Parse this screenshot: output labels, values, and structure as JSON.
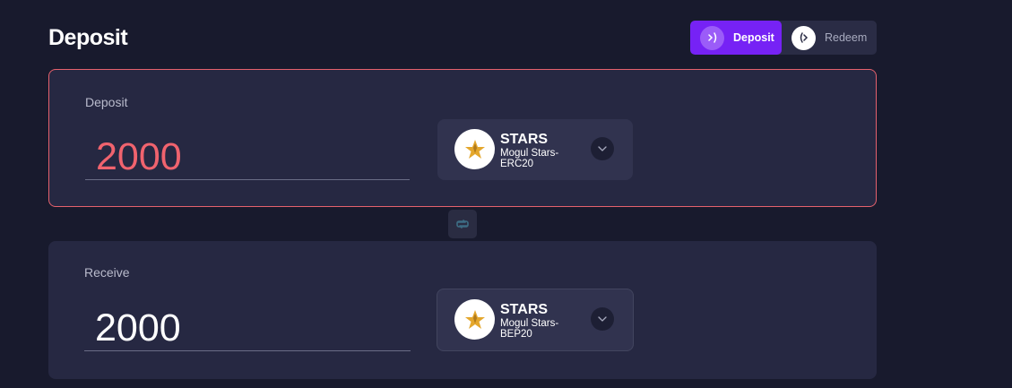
{
  "header": {
    "title": "Deposit"
  },
  "mode_toggle": {
    "deposit_label": "Deposit",
    "redeem_label": "Redeem",
    "active": "Deposit"
  },
  "deposit_card": {
    "label": "Deposit",
    "amount": "2000",
    "token": {
      "symbol": "STARS",
      "name": "Mogul Stars-ERC20",
      "icon": "star-logo-icon"
    }
  },
  "receive_card": {
    "label": "Receive",
    "amount": "2000",
    "token": {
      "symbol": "STARS",
      "name": "Mogul Stars-BEP20",
      "icon": "star-logo-icon"
    }
  },
  "colors": {
    "background": "#181a2d",
    "card": "#262842",
    "accent": "#7622f5",
    "error": "#e5616d"
  }
}
